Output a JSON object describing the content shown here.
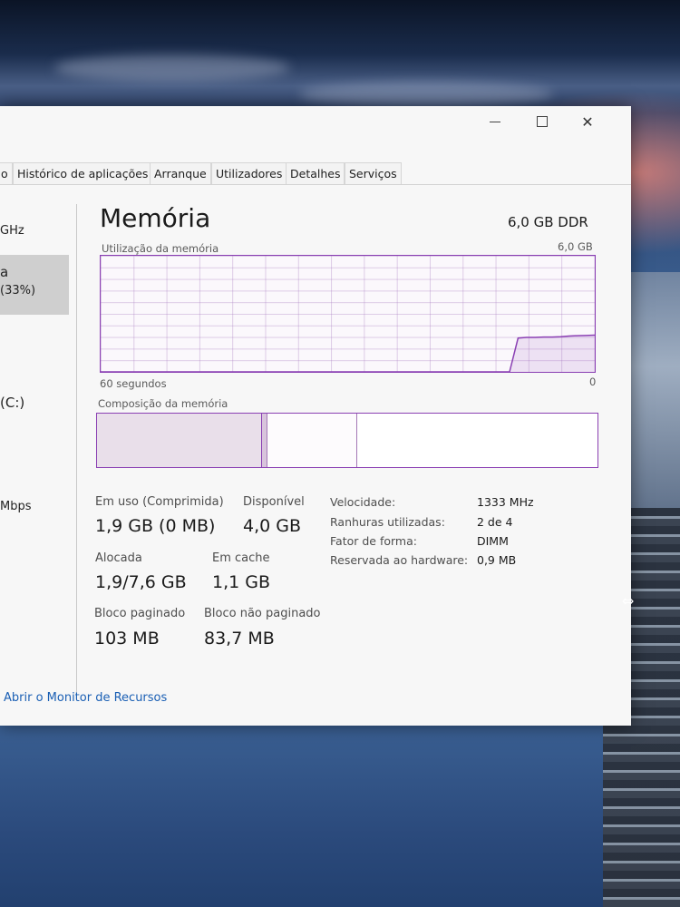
{
  "window": {
    "tabs": [
      "o",
      "Histórico de aplicações",
      "Arranque",
      "Utilizadores",
      "Detalhes",
      "Serviços"
    ]
  },
  "left_panel": {
    "items": [
      "GHz",
      "a",
      "(33%)",
      "(C:)",
      "Mbps"
    ]
  },
  "memory": {
    "title": "Memória",
    "total": "6,0 GB DDR",
    "usage_label": "Utilização da memória",
    "usage_max": "6,0 GB",
    "time_span": "60 segundos",
    "time_end": "0",
    "composition_label": "Composição da memória",
    "composition_fractions": {
      "in_use": 0.33,
      "modified": 0.01,
      "standby": 0.18,
      "free": 0.48
    },
    "usage_history_gb": [
      0,
      0,
      0,
      0,
      0,
      0,
      0,
      0,
      0,
      0,
      0,
      0,
      0,
      0,
      0,
      0,
      0,
      0,
      0,
      0,
      0,
      0,
      0,
      0,
      0,
      0,
      0,
      0,
      0,
      0,
      0,
      0,
      0,
      0,
      0,
      0,
      0,
      0,
      0,
      0,
      0,
      0,
      0,
      0,
      0,
      0,
      0,
      0,
      0,
      1.75,
      1.78,
      1.78,
      1.8,
      1.8,
      1.82,
      1.85,
      1.87,
      1.88,
      1.9
    ],
    "stats": {
      "in_use_label": "Em uso (Comprimida)",
      "in_use_value": "1,9 GB (0 MB)",
      "available_label": "Disponível",
      "available_value": "4,0 GB",
      "committed_label": "Alocada",
      "committed_value": "1,9/7,6 GB",
      "cached_label": "Em cache",
      "cached_value": "1,1 GB",
      "paged_label": "Bloco paginado",
      "paged_value": "103 MB",
      "nonpaged_label": "Bloco não paginado",
      "nonpaged_value": "83,7 MB"
    },
    "properties": [
      {
        "label": "Velocidade:",
        "value": "1333 MHz"
      },
      {
        "label": "Ranhuras utilizadas:",
        "value": "2 de 4"
      },
      {
        "label": "Fator de forma:",
        "value": "DIMM"
      },
      {
        "label": "Reservada ao hardware:",
        "value": "0,9 MB"
      }
    ]
  },
  "footer": {
    "link": "Abrir o Monitor de Recursos"
  },
  "colors": {
    "accent": "#8a3fb3",
    "link": "#1a5fb4"
  }
}
